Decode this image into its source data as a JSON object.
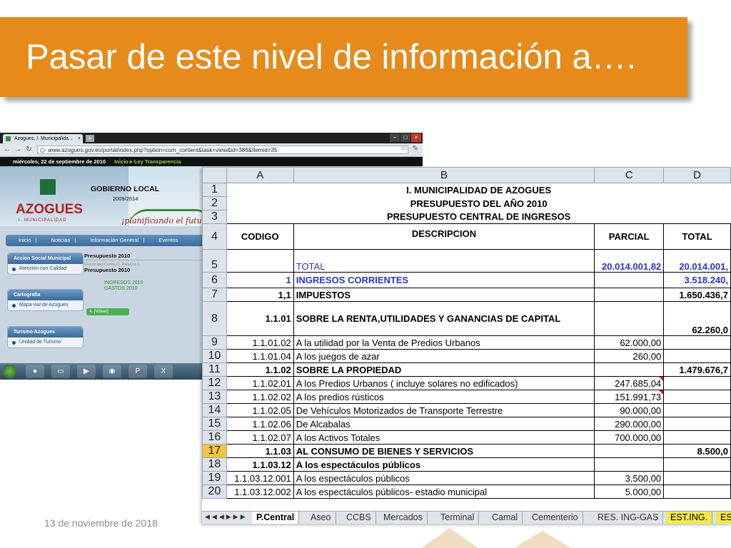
{
  "slide": {
    "title": "Pasar de este nivel de información a….",
    "footer_date": "13 de noviembre de 2018"
  },
  "browser": {
    "tab_title": "Azogues, I. Municipalida...",
    "tab_close": "×",
    "new_tab": "+",
    "url": "www.azogues.gov.ec/portal/index.php?option=com_content&task=view&id=386&Itemid=35",
    "date_line": "miércoles, 22 de septiembre de 2010",
    "top_nav": "Inicio ▸ Ley Transparencia",
    "header": {
      "gobierno": "GOBIERNO LOCAL",
      "years": "2009/2014",
      "logo": "AZOGUES",
      "logo_sub": "I. MUNICIPALIDAD",
      "slogan": "¡planificando el futu"
    },
    "menu": [
      "Inicio",
      "Noticias",
      "Información General",
      "Eventos"
    ],
    "sidebar": [
      {
        "title": "Accion Social Municipal",
        "item": "Atención con Calidad"
      },
      {
        "title": "Cartografia",
        "item": "Mapa vial de Azogues"
      },
      {
        "title": "Turismo Azogues",
        "item": "Unidad de Turismo"
      }
    ],
    "content": {
      "title": "Presupuesto 2010",
      "author": "Escrito por Carlos O. Palacios L.",
      "subtitle": "Presupuesto 2010",
      "links": [
        "INGRESOS 2010",
        "GASTOS 2010"
      ],
      "back": "4.  [Volver]"
    }
  },
  "sheet": {
    "columns": [
      "A",
      "B",
      "C",
      "D"
    ],
    "titles": [
      "I. MUNICIPALIDAD DE AZOGUES",
      "PRESUPUESTO DEL AÑO 2010",
      "PRESUPUESTO CENTRAL DE INGRESOS"
    ],
    "headers": {
      "codigo": "CODIGO",
      "descripcion": "DESCRIPCION",
      "parcial": "PARCIAL",
      "total": "TOTAL"
    },
    "rows": [
      {
        "n": "5",
        "code": "",
        "desc": "TOTAL",
        "parcial": "20.014.001,82",
        "total": "20.014.001,"
      },
      {
        "n": "6",
        "code": "1",
        "desc": "INGRESOS CORRIENTES",
        "parcial": "",
        "total": "3.518.240,"
      },
      {
        "n": "7",
        "code": "1,1",
        "desc": "IMPUESTOS",
        "parcial": "",
        "total": "1.650.436,7"
      },
      {
        "n": "8",
        "code": "1.1.01",
        "desc": "SOBRE LA RENTA,UTILIDADES Y GANANCIAS DE CAPITAL",
        "parcial": "",
        "total": "62.260,0"
      },
      {
        "n": "9",
        "code": "1.1.01.02",
        "desc": "A la utilidad por la Venta de Predios Urbanos",
        "parcial": "62.000,00",
        "total": ""
      },
      {
        "n": "10",
        "code": "1.1.01.04",
        "desc": "A los juegos de azar",
        "parcial": "260,00",
        "total": ""
      },
      {
        "n": "11",
        "code": "1.1.02",
        "desc": "SOBRE LA PROPIEDAD",
        "parcial": "",
        "total": "1.479.676,7"
      },
      {
        "n": "12",
        "code": "1.1.02.01",
        "desc": "A los Predios Urbanos ( incluye solares no edificados)",
        "parcial": "247.685,04",
        "total": ""
      },
      {
        "n": "13",
        "code": "1.1.02.02",
        "desc": "A los predios rústicos",
        "parcial": "151.991,73",
        "total": ""
      },
      {
        "n": "14",
        "code": "1.1.02.05",
        "desc": "De Vehículos Motorizados de Transporte Terrestre",
        "parcial": "90.000,00",
        "total": ""
      },
      {
        "n": "15",
        "code": "1.1.02.06",
        "desc": "De Alcabalas",
        "parcial": "290.000,00",
        "total": ""
      },
      {
        "n": "16",
        "code": "1.1.02.07",
        "desc": "A los Activos Totales",
        "parcial": "700.000,00",
        "total": ""
      },
      {
        "n": "17",
        "code": "1.1.03",
        "desc": "AL CONSUMO DE BIENES Y SERVICIOS",
        "parcial": "",
        "total": "8.500,0"
      },
      {
        "n": "18",
        "code": "1.1.03.12",
        "desc": "A los espectáculos públicos",
        "parcial": "",
        "total": ""
      },
      {
        "n": "19",
        "code": "1.1.03.12.001",
        "desc": "A los espectáculos públicos",
        "parcial": "3.500,00",
        "total": ""
      },
      {
        "n": "20",
        "code": "1.1.03.12.002",
        "desc": "A los espectáculos públicos- estadio municipal",
        "parcial": "5.000,00",
        "total": ""
      }
    ],
    "tabs": [
      "P.Central",
      "Aseo",
      "CCBS",
      "Mercados",
      "Terminal",
      "Camal",
      "Cementerio",
      "RES. ING-GAS",
      "EST.ING.",
      "ES"
    ],
    "tab_nav": "◀◀◀▶▶▶",
    "selected_row": "17",
    "row_labels": [
      "1",
      "2",
      "3",
      "4"
    ],
    "comment_color": "#d81b1b",
    "blue_color": "#2b35c8",
    "banner_color": "#e68a1b"
  }
}
